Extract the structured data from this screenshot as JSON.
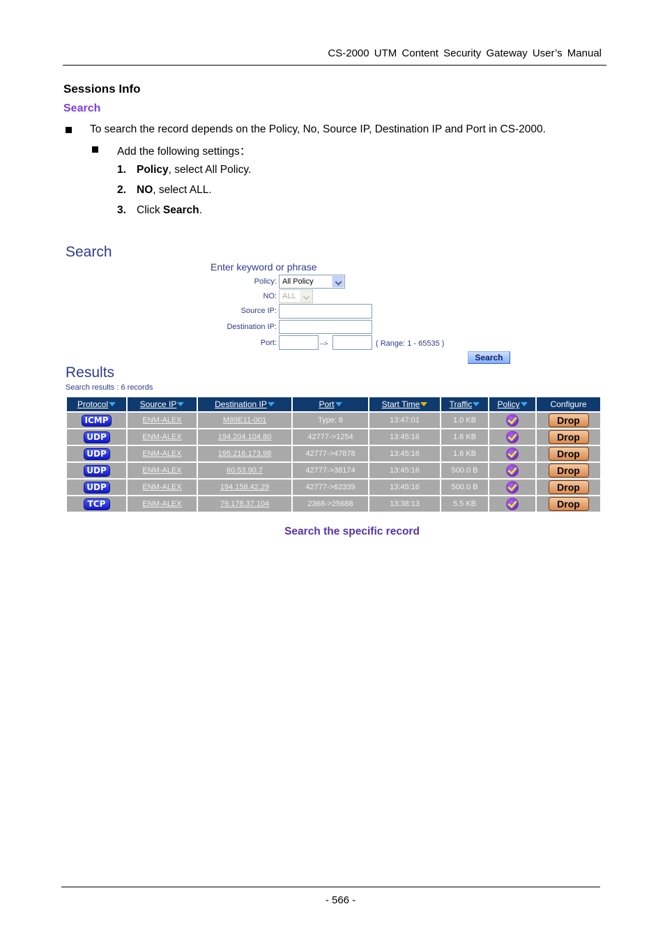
{
  "header": {
    "manual_title": "CS-2000 UTM Content Security Gateway User’s Manual"
  },
  "section": {
    "title": "Sessions Info",
    "subtitle": "Search",
    "bullet1": "To search the record depends on the Policy, No, Source IP, Destination IP and Port in CS-2000.",
    "bullet2": "Add the following settings：",
    "steps": [
      {
        "num": "1.",
        "bold": "Policy",
        "rest": ", select All Policy."
      },
      {
        "num": "2.",
        "bold": "NO",
        "rest": ", select ALL."
      },
      {
        "num": "3.",
        "pre": "Click ",
        "bold": "Search",
        "rest": "."
      }
    ]
  },
  "search_form": {
    "title": "Search",
    "hint": "Enter keyword or phrase",
    "policy_label": "Policy:",
    "policy_value": "All Policy",
    "no_label": "NO:",
    "no_value": "ALL",
    "source_ip_label": "Source IP:",
    "source_ip_value": "",
    "destination_ip_label": "Destination IP:",
    "destination_ip_value": "",
    "port_label": "Port:",
    "port_from_value": "",
    "port_arrow": "-->",
    "port_to_value": "",
    "port_range": "( Range: 1 - 65535 )",
    "search_button": "Search"
  },
  "results": {
    "title": "Results",
    "count_text": "Search results : 6 records",
    "columns": [
      "Protocol",
      "Source IP",
      "Destination IP",
      "Port",
      "Start Time",
      "Traffic",
      "Policy",
      "Configure"
    ],
    "sorted_column": "Start Time",
    "rows": [
      {
        "protocol": "ICMP",
        "source_ip": "ENM-ALEX",
        "destination_ip": "M89E11-001",
        "port": "Type: 8",
        "start_time": "13:47:01",
        "traffic": "1.0 KB",
        "policy_icon": "check-icon",
        "action": "Drop"
      },
      {
        "protocol": "UDP",
        "source_ip": "ENM-ALEX",
        "destination_ip": "194.204.104.80",
        "port": "42777->1254",
        "start_time": "13:45:16",
        "traffic": "1.6 KB",
        "policy_icon": "check-icon",
        "action": "Drop"
      },
      {
        "protocol": "UDP",
        "source_ip": "ENM-ALEX",
        "destination_ip": "195.216.173.98",
        "port": "42777->47878",
        "start_time": "13:45:16",
        "traffic": "1.6 KB",
        "policy_icon": "check-icon",
        "action": "Drop"
      },
      {
        "protocol": "UDP",
        "source_ip": "ENM-ALEX",
        "destination_ip": "60.53.90.7",
        "port": "42777->38174",
        "start_time": "13:45:16",
        "traffic": "500.0 B",
        "policy_icon": "check-icon",
        "action": "Drop"
      },
      {
        "protocol": "UDP",
        "source_ip": "ENM-ALEX",
        "destination_ip": "194.158.42.29",
        "port": "42777->62339",
        "start_time": "13:45:16",
        "traffic": "500.0 B",
        "policy_icon": "check-icon",
        "action": "Drop"
      },
      {
        "protocol": "TCP",
        "source_ip": "ENM-ALEX",
        "destination_ip": "79.178.37.104",
        "port": "2368->25688",
        "start_time": "13:38:13",
        "traffic": "5.5 KB",
        "policy_icon": "check-icon",
        "action": "Drop"
      }
    ]
  },
  "caption": "Search the specific record",
  "footer": {
    "page": "- 566 -"
  },
  "colors": {
    "heading_purple": "#7b3fe4",
    "caption_purple": "#5a32a8",
    "ui_blue": "#2b3a8f",
    "table_header": "#0f3a6e",
    "table_cell": "#a9a9a9"
  }
}
